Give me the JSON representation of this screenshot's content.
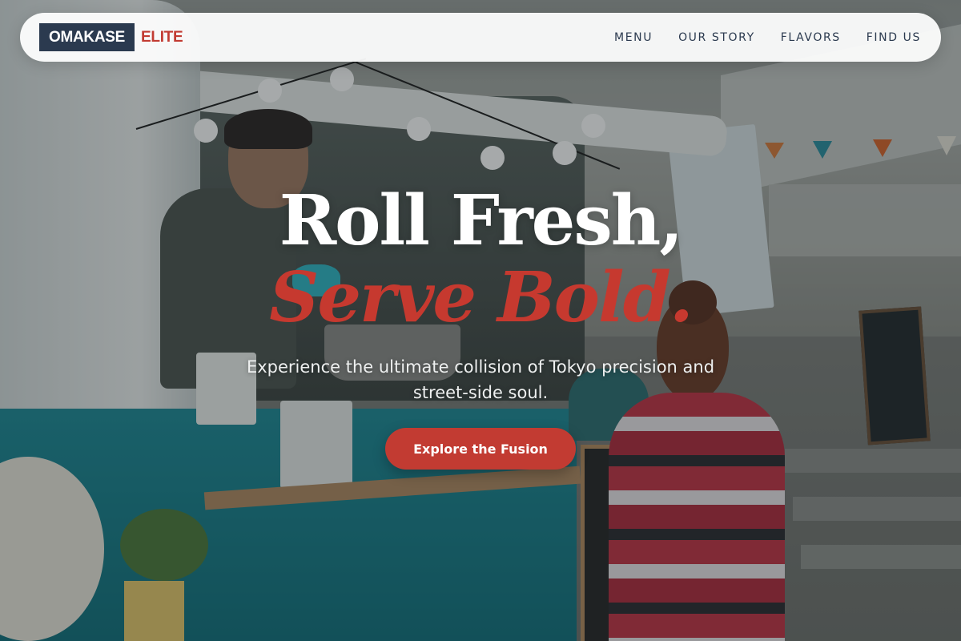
{
  "brand": {
    "name": "OMAKASE",
    "accent": "ELITE"
  },
  "nav": {
    "links": [
      "MENU",
      "OUR STORY",
      "FLAVORS",
      "FIND US"
    ]
  },
  "hero": {
    "headline_line1": "Roll Fresh,",
    "headline_line2": "Serve Bold.",
    "subtitle": "Experience the ultimate collision of Tokyo precision and street-side soul.",
    "cta_label": "Explore the Fusion",
    "background_image": "food-truck-photo"
  },
  "colors": {
    "brand_dark": "#2b3a4f",
    "accent_red": "#c23b32",
    "nav_background": "#ffffff"
  }
}
